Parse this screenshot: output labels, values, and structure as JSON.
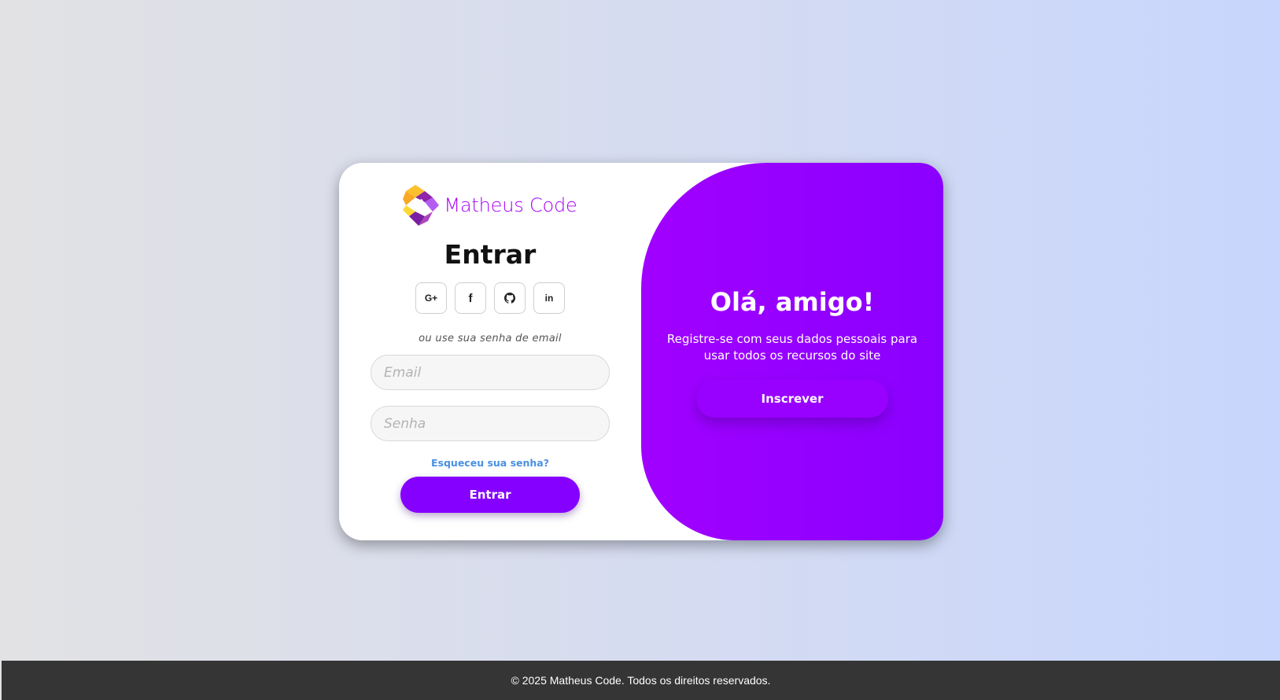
{
  "brand": {
    "name": "Matheus Code",
    "logo_icon": "puzzle-diamond-icon",
    "colors": {
      "accent": "#8500ff",
      "brand_text": "#a400f5",
      "logo_yellow": "#fbc02d"
    }
  },
  "login": {
    "title": "Entrar",
    "socials": [
      {
        "icon": "google-plus-icon",
        "label": "G+"
      },
      {
        "icon": "facebook-icon",
        "label": "f"
      },
      {
        "icon": "github-icon",
        "label": ""
      },
      {
        "icon": "linkedin-icon",
        "label": "in"
      }
    ],
    "hint": "ou use sua senha de email",
    "email_placeholder": "Email",
    "password_placeholder": "Senha",
    "forgot": "Esqueceu sua senha?",
    "submit": "Entrar"
  },
  "panel": {
    "title": "Olá, amigo!",
    "subtitle": "Registre-se com seus dados pessoais para usar todos os recursos do site",
    "button": "Inscrever"
  },
  "footer": {
    "text": "© 2025 Matheus Code. Todos os direitos reservados."
  }
}
